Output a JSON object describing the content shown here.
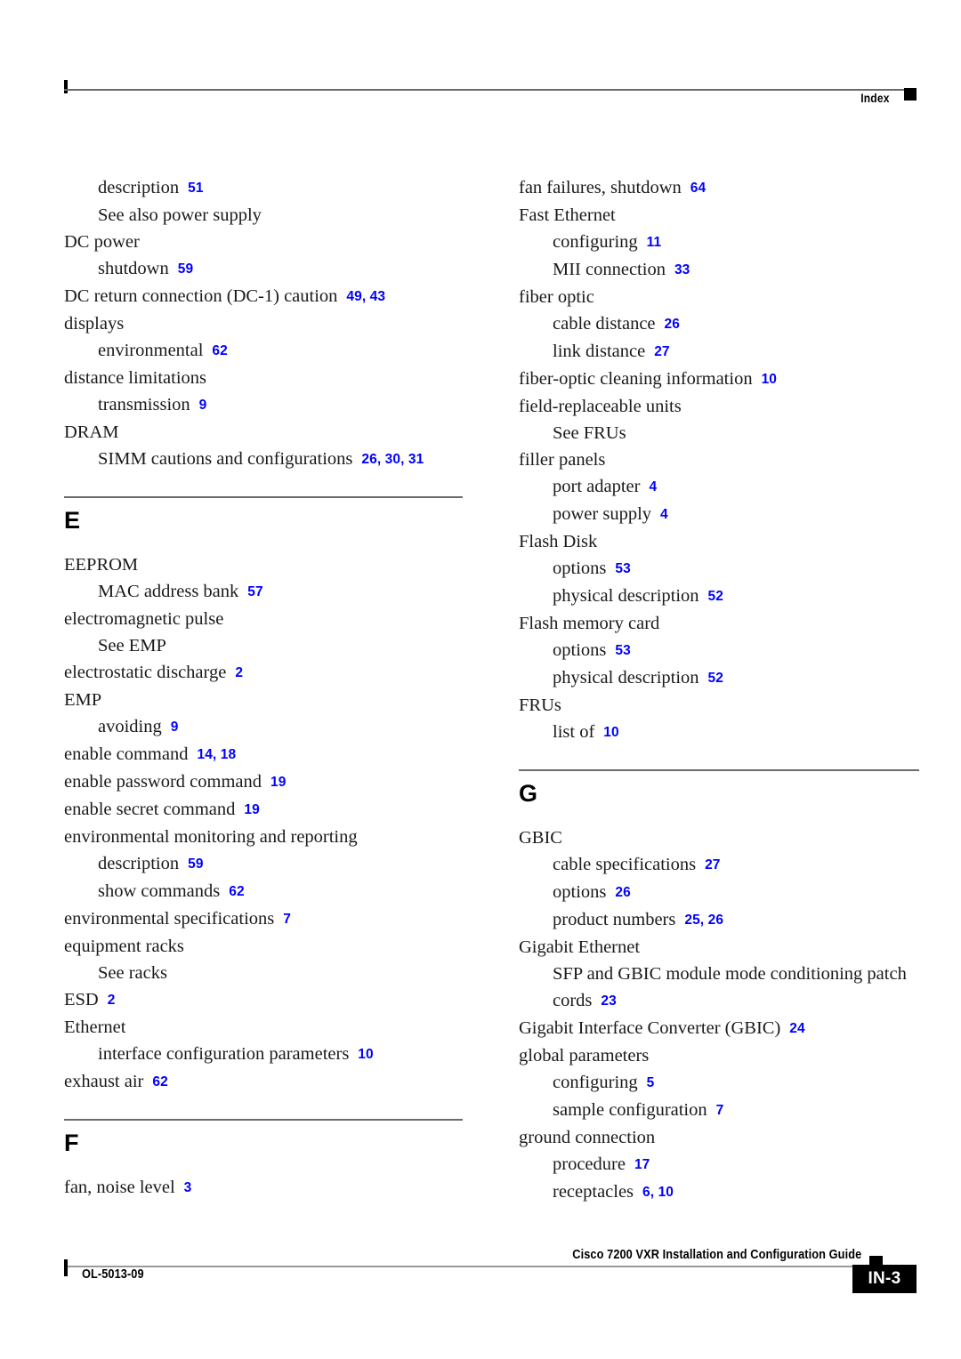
{
  "header": {
    "title": "Index",
    "square_icon": "black-square-marker"
  },
  "footer": {
    "doc_id": "OL-5013-09",
    "guide_title": "Cisco 7200 VXR Installation and Configuration Guide",
    "page_number": "IN-3",
    "square_icon": "black-square-marker"
  },
  "colors": {
    "page_number_link": "#0000FF",
    "body_text": "#1A1A1A",
    "rule": "#6B6B6B",
    "marker": "#000000"
  },
  "columns": {
    "left": {
      "continued_entries": [
        {
          "level": 1,
          "term": "description",
          "pages": "51"
        },
        {
          "level": 1,
          "term": "See also power supply",
          "pages": ""
        },
        {
          "level": 0,
          "term": "DC power",
          "pages": ""
        },
        {
          "level": 1,
          "term": "shutdown",
          "pages": "59"
        },
        {
          "level": 0,
          "term": "DC return connection (DC-1) caution",
          "pages": "49, 43"
        },
        {
          "level": 0,
          "term": "displays",
          "pages": ""
        },
        {
          "level": 1,
          "term": "environmental",
          "pages": "62"
        },
        {
          "level": 0,
          "term": "distance limitations",
          "pages": ""
        },
        {
          "level": 1,
          "term": "transmission",
          "pages": "9"
        },
        {
          "level": 0,
          "term": "DRAM",
          "pages": ""
        },
        {
          "level": 1,
          "term": "SIMM cautions and configurations",
          "pages": "26, 30, 31"
        }
      ],
      "sections": [
        {
          "letter": "E",
          "entries": [
            {
              "level": 0,
              "term": "EEPROM",
              "pages": ""
            },
            {
              "level": 1,
              "term": "MAC address bank",
              "pages": "57"
            },
            {
              "level": 0,
              "term": "electromagnetic pulse",
              "pages": ""
            },
            {
              "level": 1,
              "term": "See EMP",
              "pages": ""
            },
            {
              "level": 0,
              "term": "electrostatic discharge",
              "pages": "2"
            },
            {
              "level": 0,
              "term": "EMP",
              "pages": ""
            },
            {
              "level": 1,
              "term": "avoiding",
              "pages": "9"
            },
            {
              "level": 0,
              "term": "enable command",
              "pages": "14, 18"
            },
            {
              "level": 0,
              "term": "enable password command",
              "pages": "19"
            },
            {
              "level": 0,
              "term": "enable secret command",
              "pages": "19"
            },
            {
              "level": 0,
              "term": "environmental monitoring and reporting",
              "pages": ""
            },
            {
              "level": 1,
              "term": "description",
              "pages": "59"
            },
            {
              "level": 1,
              "term": "show commands",
              "pages": "62"
            },
            {
              "level": 0,
              "term": "environmental specifications",
              "pages": "7"
            },
            {
              "level": 0,
              "term": "equipment racks",
              "pages": ""
            },
            {
              "level": 1,
              "term": "See racks",
              "pages": ""
            },
            {
              "level": 0,
              "term": "ESD",
              "pages": "2"
            },
            {
              "level": 0,
              "term": "Ethernet",
              "pages": ""
            },
            {
              "level": 1,
              "term": "interface configuration parameters",
              "pages": "10"
            },
            {
              "level": 0,
              "term": "exhaust air",
              "pages": "62"
            }
          ]
        },
        {
          "letter": "F",
          "entries": [
            {
              "level": 0,
              "term": "fan, noise level",
              "pages": "3"
            }
          ]
        }
      ]
    },
    "right": {
      "continued_entries": [
        {
          "level": 0,
          "term": "fan failures, shutdown",
          "pages": "64"
        },
        {
          "level": 0,
          "term": "Fast Ethernet",
          "pages": ""
        },
        {
          "level": 1,
          "term": "configuring",
          "pages": "11"
        },
        {
          "level": 1,
          "term": "MII connection",
          "pages": "33"
        },
        {
          "level": 0,
          "term": "fiber optic",
          "pages": ""
        },
        {
          "level": 1,
          "term": "cable distance",
          "pages": "26"
        },
        {
          "level": 1,
          "term": "link distance",
          "pages": "27"
        },
        {
          "level": 0,
          "term": "fiber-optic cleaning information",
          "pages": "10"
        },
        {
          "level": 0,
          "term": "field-replaceable units",
          "pages": ""
        },
        {
          "level": 1,
          "term": "See FRUs",
          "pages": ""
        },
        {
          "level": 0,
          "term": "filler panels",
          "pages": ""
        },
        {
          "level": 1,
          "term": "port adapter",
          "pages": "4"
        },
        {
          "level": 1,
          "term": "power supply",
          "pages": "4"
        },
        {
          "level": 0,
          "term": "Flash Disk",
          "pages": ""
        },
        {
          "level": 1,
          "term": "options",
          "pages": "53"
        },
        {
          "level": 1,
          "term": "physical description",
          "pages": "52"
        },
        {
          "level": 0,
          "term": "Flash memory card",
          "pages": ""
        },
        {
          "level": 1,
          "term": "options",
          "pages": "53"
        },
        {
          "level": 1,
          "term": "physical description",
          "pages": "52"
        },
        {
          "level": 0,
          "term": "FRUs",
          "pages": ""
        },
        {
          "level": 1,
          "term": "list of",
          "pages": "10"
        }
      ],
      "sections": [
        {
          "letter": "G",
          "entries": [
            {
              "level": 0,
              "term": "GBIC",
              "pages": ""
            },
            {
              "level": 1,
              "term": "cable specifications",
              "pages": "27"
            },
            {
              "level": 1,
              "term": "options",
              "pages": "26"
            },
            {
              "level": 1,
              "term": "product numbers",
              "pages": "25, 26"
            },
            {
              "level": 0,
              "term": "Gigabit Ethernet",
              "pages": ""
            },
            {
              "level": 1,
              "wrap": true,
              "term": "SFP and GBIC module mode conditioning patch cords",
              "pages": "23"
            },
            {
              "level": 0,
              "term": "Gigabit Interface Converter (GBIC)",
              "pages": "24"
            },
            {
              "level": 0,
              "term": "global parameters",
              "pages": ""
            },
            {
              "level": 1,
              "term": "configuring",
              "pages": "5"
            },
            {
              "level": 1,
              "term": "sample configuration",
              "pages": "7"
            },
            {
              "level": 0,
              "term": "ground connection",
              "pages": ""
            },
            {
              "level": 1,
              "term": "procedure",
              "pages": "17"
            },
            {
              "level": 1,
              "term": "receptacles",
              "pages": "6, 10"
            }
          ]
        }
      ]
    }
  }
}
